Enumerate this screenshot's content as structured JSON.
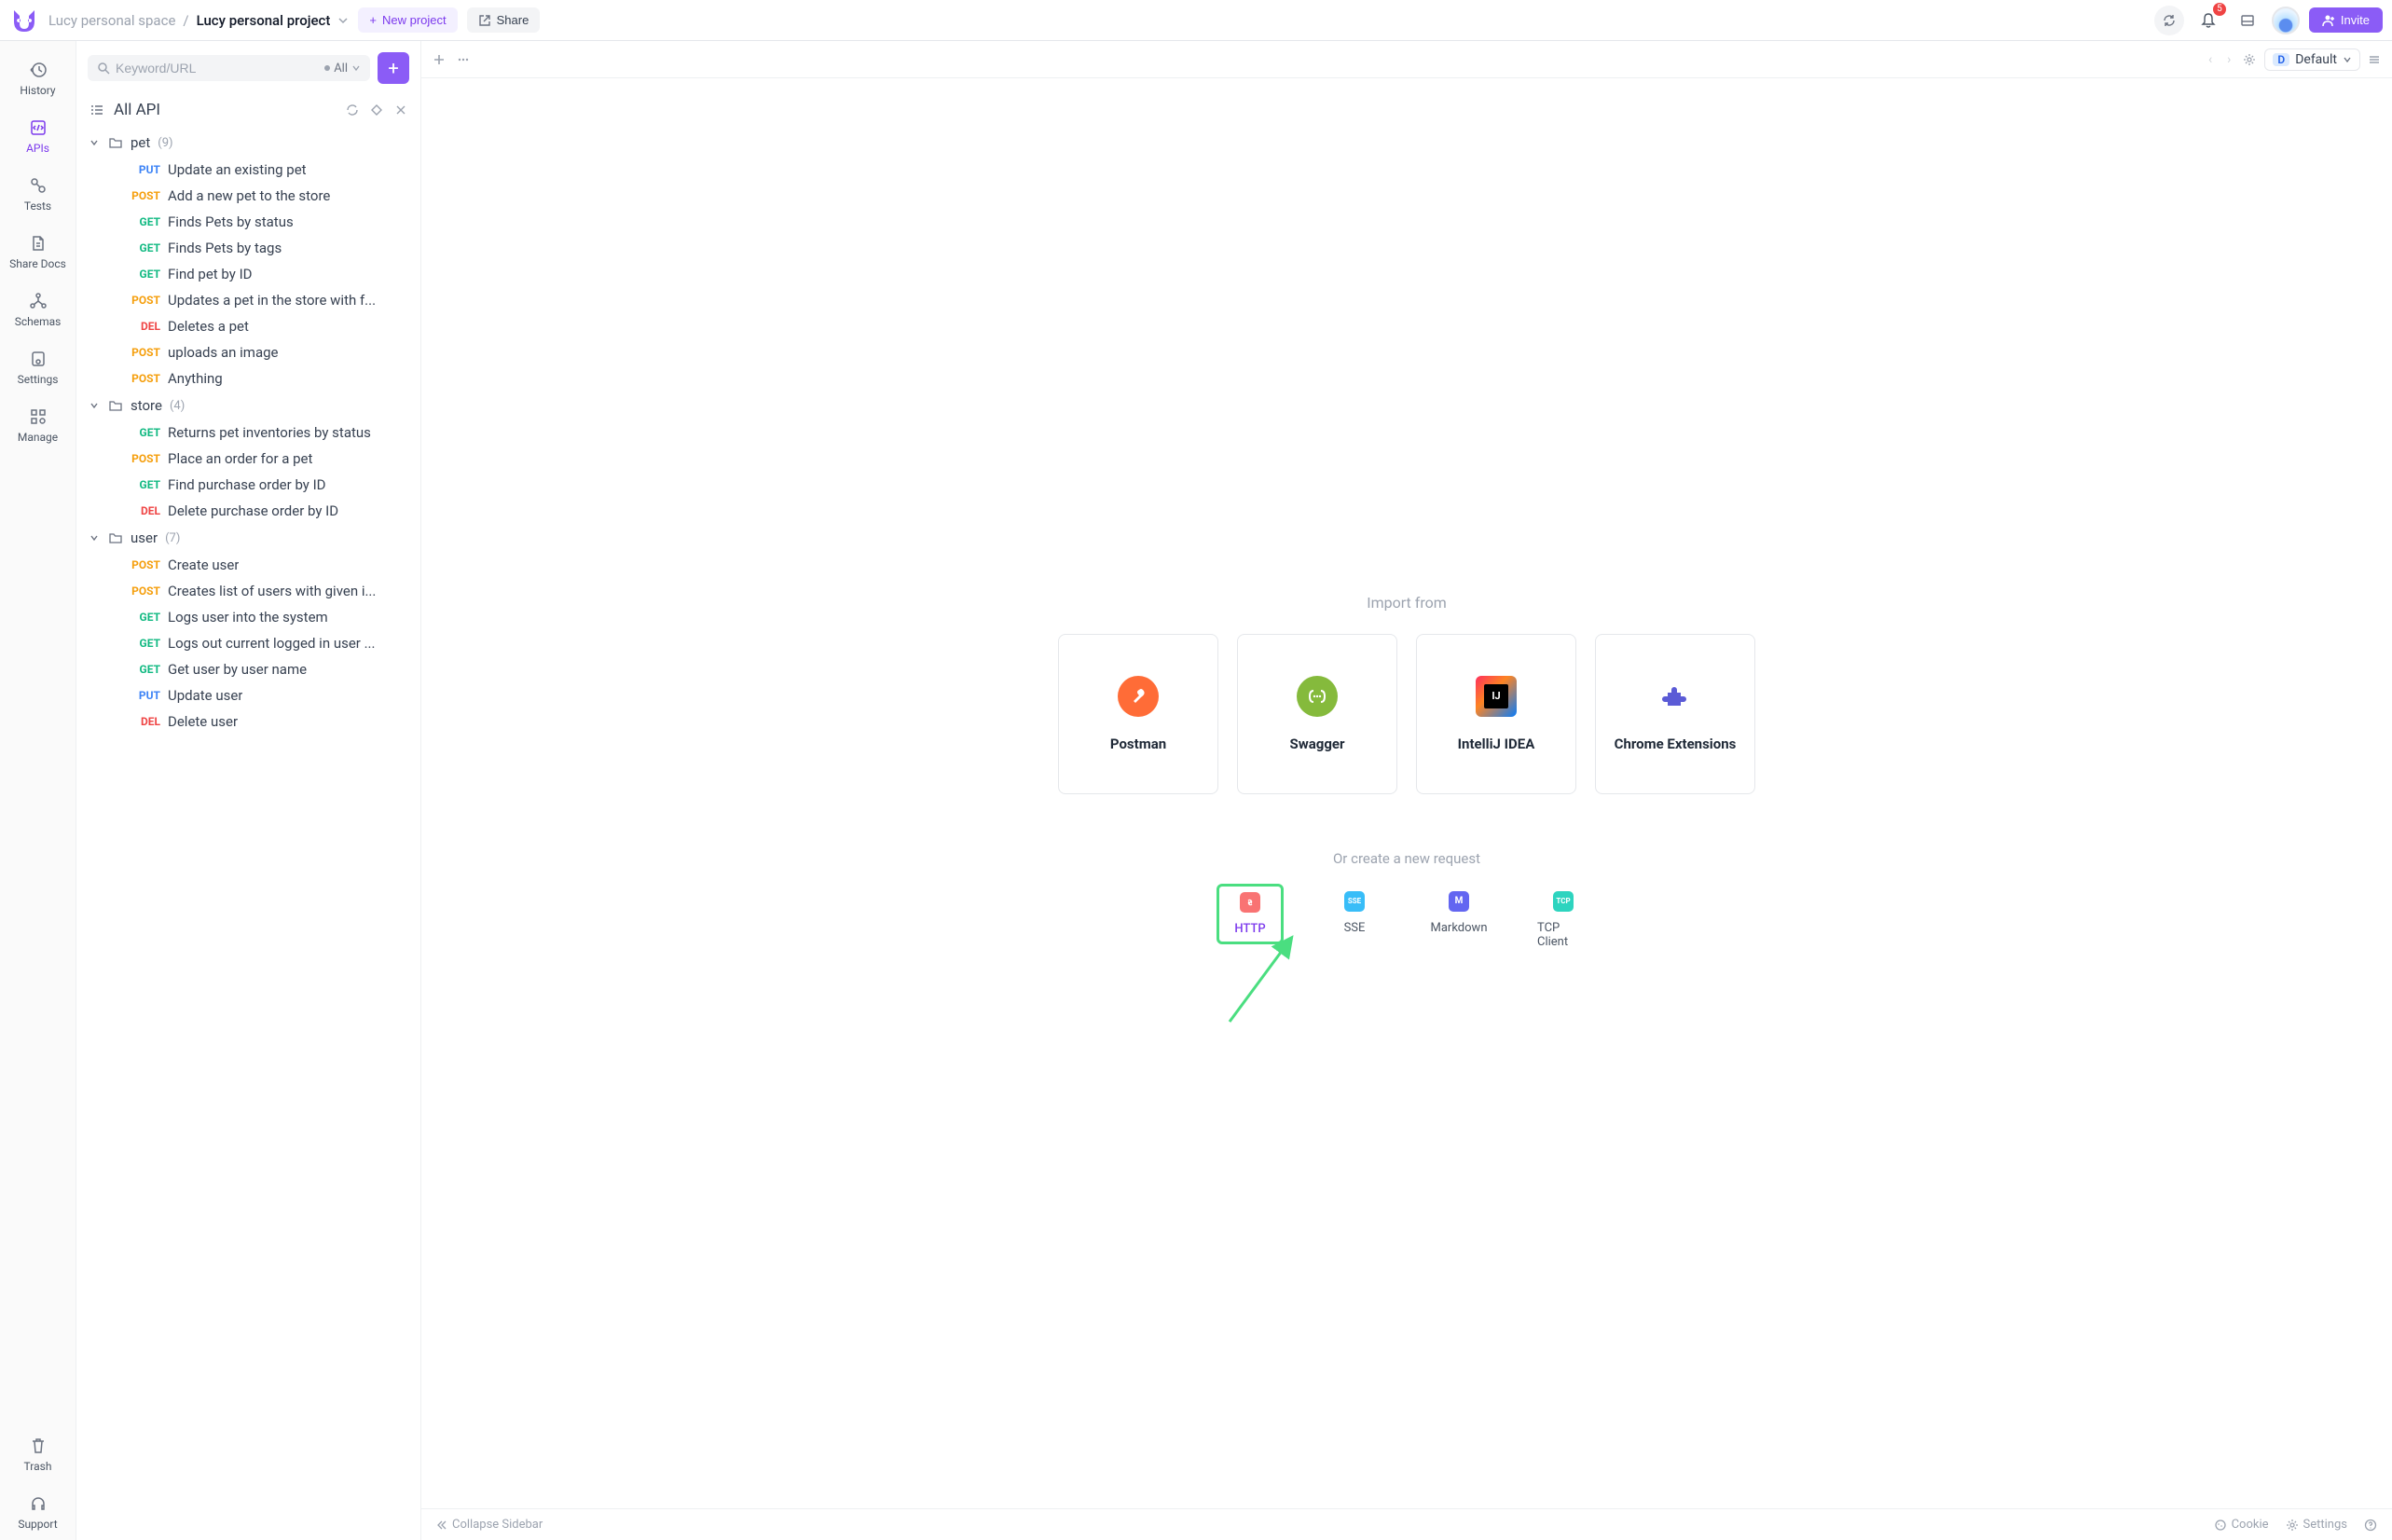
{
  "topbar": {
    "breadcrumb_space": "Lucy personal space",
    "breadcrumb_project": "Lucy personal project",
    "new_project": "New project",
    "share": "Share",
    "invite": "Invite",
    "notification_count": "5"
  },
  "rail": {
    "history": "History",
    "apis": "APIs",
    "tests": "Tests",
    "share_docs": "Share Docs",
    "schemas": "Schemas",
    "settings": "Settings",
    "manage": "Manage",
    "trash": "Trash",
    "support": "Support"
  },
  "sidebar": {
    "search_placeholder": "Keyword/URL",
    "filter_label": "All",
    "head_title": "All API",
    "folders": [
      {
        "name": "pet",
        "count": "(9)",
        "items": [
          {
            "method": "PUT",
            "label": "Update an existing pet"
          },
          {
            "method": "POST",
            "label": "Add a new pet to the store"
          },
          {
            "method": "GET",
            "label": "Finds Pets by status"
          },
          {
            "method": "GET",
            "label": "Finds Pets by tags"
          },
          {
            "method": "GET",
            "label": "Find pet by ID"
          },
          {
            "method": "POST",
            "label": "Updates a pet in the store with f..."
          },
          {
            "method": "DEL",
            "label": "Deletes a pet"
          },
          {
            "method": "POST",
            "label": "uploads an image"
          },
          {
            "method": "POST",
            "label": "Anything"
          }
        ]
      },
      {
        "name": "store",
        "count": "(4)",
        "items": [
          {
            "method": "GET",
            "label": "Returns pet inventories by status"
          },
          {
            "method": "POST",
            "label": "Place an order for a pet"
          },
          {
            "method": "GET",
            "label": "Find purchase order by ID"
          },
          {
            "method": "DEL",
            "label": "Delete purchase order by ID"
          }
        ]
      },
      {
        "name": "user",
        "count": "(7)",
        "items": [
          {
            "method": "POST",
            "label": "Create user"
          },
          {
            "method": "POST",
            "label": "Creates list of users with given i..."
          },
          {
            "method": "GET",
            "label": "Logs user into the system"
          },
          {
            "method": "GET",
            "label": "Logs out current logged in user ..."
          },
          {
            "method": "GET",
            "label": "Get user by user name"
          },
          {
            "method": "PUT",
            "label": "Update user"
          },
          {
            "method": "DEL",
            "label": "Delete user"
          }
        ]
      }
    ]
  },
  "tabbar": {
    "env_label": "Default"
  },
  "main": {
    "import_label": "Import from",
    "cards": {
      "postman": "Postman",
      "swagger": "Swagger",
      "intellij": "IntelliJ IDEA",
      "chrome": "Chrome Extensions"
    },
    "create_label": "Or create a new request",
    "create": {
      "http": "HTTP",
      "sse": "SSE",
      "markdown": "Markdown",
      "tcp": "TCP Client"
    }
  },
  "footer": {
    "collapse": "Collapse Sidebar",
    "cookie": "Cookie",
    "settings": "Settings"
  }
}
